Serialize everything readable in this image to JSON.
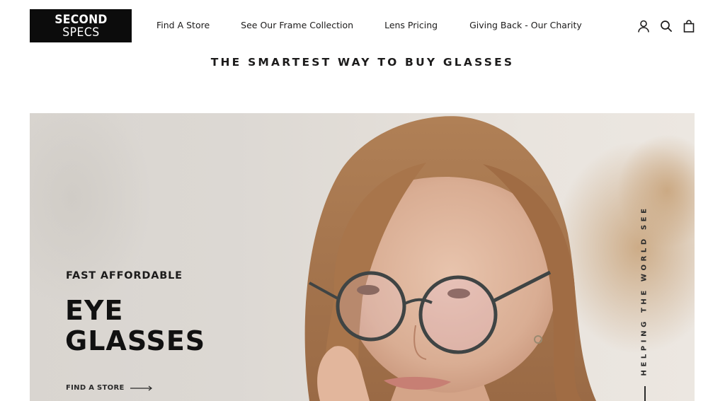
{
  "header": {
    "logo": {
      "line1": "SECOND",
      "line2": "SPECS"
    },
    "nav": [
      {
        "label": "Find A Store"
      },
      {
        "label": "See Our Frame Collection"
      },
      {
        "label": "Lens Pricing"
      },
      {
        "label": "Giving Back - Our Charity"
      }
    ],
    "icons": [
      "account-icon",
      "search-icon",
      "cart-icon"
    ]
  },
  "tagline": "THE SMARTEST WAY TO BUY GLASSES",
  "hero": {
    "eyebrow": "FAST AFFORDABLE",
    "headline_line1": "EYE",
    "headline_line2": "GLASSES",
    "cta_label": "FIND A STORE",
    "vertical_text": "HELPING THE WORLD SEE"
  },
  "colors": {
    "text": "#1c1b1b",
    "logo_bg": "#0c0c0c",
    "hero_bg": "#dcd8d3"
  }
}
